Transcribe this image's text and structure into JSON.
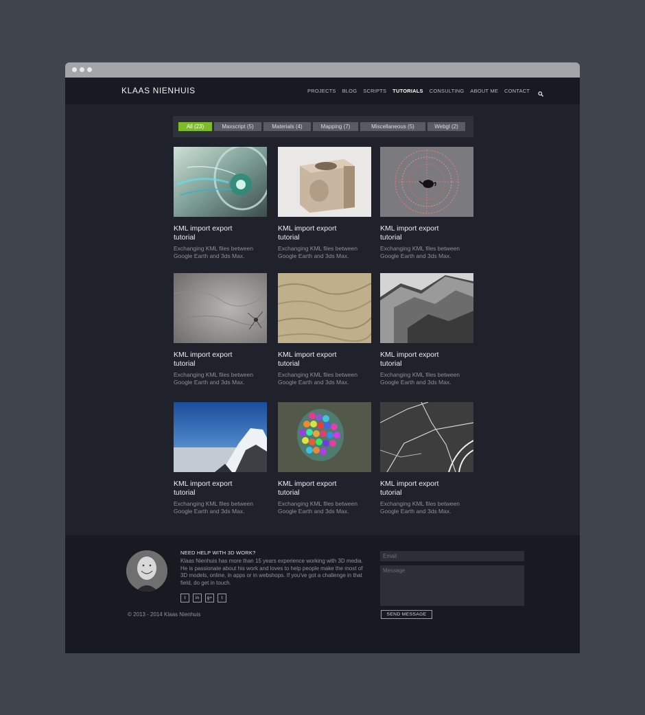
{
  "site": {
    "brand": "KLAAS NIENHUIS"
  },
  "nav": {
    "items": [
      {
        "label": "PROJECTS",
        "active": false
      },
      {
        "label": "BLOG",
        "active": false
      },
      {
        "label": "SCRIPTS",
        "active": false
      },
      {
        "label": "TUTORIALS",
        "active": true
      },
      {
        "label": "CONSULTING",
        "active": false
      },
      {
        "label": "ABOUT ME",
        "active": false
      },
      {
        "label": "CONTACT",
        "active": false
      }
    ],
    "search_icon": "search-icon"
  },
  "filters": [
    {
      "label": "All (23)",
      "active": true
    },
    {
      "label": "Maxscript (5)",
      "active": false
    },
    {
      "label": "Materials (4)",
      "active": false
    },
    {
      "label": "Mapping (7)",
      "active": false
    },
    {
      "label": "Miscellaneous (5)",
      "active": false
    },
    {
      "label": "Webgl (2)",
      "active": false
    }
  ],
  "tutorials": [
    {
      "title": "KML import export tutorial",
      "desc": "Exchanging KML files between Google Earth and 3ds Max."
    },
    {
      "title": "KML import export tutorial",
      "desc": "Exchanging KML files between Google Earth and 3ds Max."
    },
    {
      "title": "KML import export tutorial",
      "desc": "Exchanging KML files between Google Earth and 3ds Max."
    },
    {
      "title": "KML import export tutorial",
      "desc": "Exchanging KML files between Google Earth and 3ds Max."
    },
    {
      "title": "KML import export tutorial",
      "desc": "Exchanging KML files between Google Earth and 3ds Max."
    },
    {
      "title": "KML import export tutorial",
      "desc": "Exchanging KML files between Google Earth and 3ds Max."
    },
    {
      "title": "KML import export tutorial",
      "desc": "Exchanging KML files between Google Earth and 3ds Max."
    },
    {
      "title": "KML import export tutorial",
      "desc": "Exchanging KML files between Google Earth and 3ds Max."
    },
    {
      "title": "KML import export tutorial",
      "desc": "Exchanging KML files between Google Earth and 3ds Max."
    }
  ],
  "footer": {
    "help_title": "NEED HELP WITH 3D WORK?",
    "help_text": "Klaas Nienhuis has more than 15 years experience working with 3D media. He is passionate about his work and loves to help people make the most of 3D models, online, in apps or in webshops. If you've got a challenge in that field, do get in touch.",
    "socials": [
      {
        "icon": "twitter-icon",
        "glyph": "t"
      },
      {
        "icon": "linkedin-icon",
        "glyph": "in"
      },
      {
        "icon": "googleplus-icon",
        "glyph": "g+"
      },
      {
        "icon": "tumblr-icon",
        "glyph": "t"
      }
    ],
    "copyright": "© 2013 - 2014 Klaas Nienhuis",
    "email_placeholder": "Email",
    "message_placeholder": "Message",
    "send_label": "SEND MESSAGE"
  },
  "colors": {
    "accent": "#7dbb2b",
    "background": "#1f222a",
    "page": "#40444d"
  }
}
